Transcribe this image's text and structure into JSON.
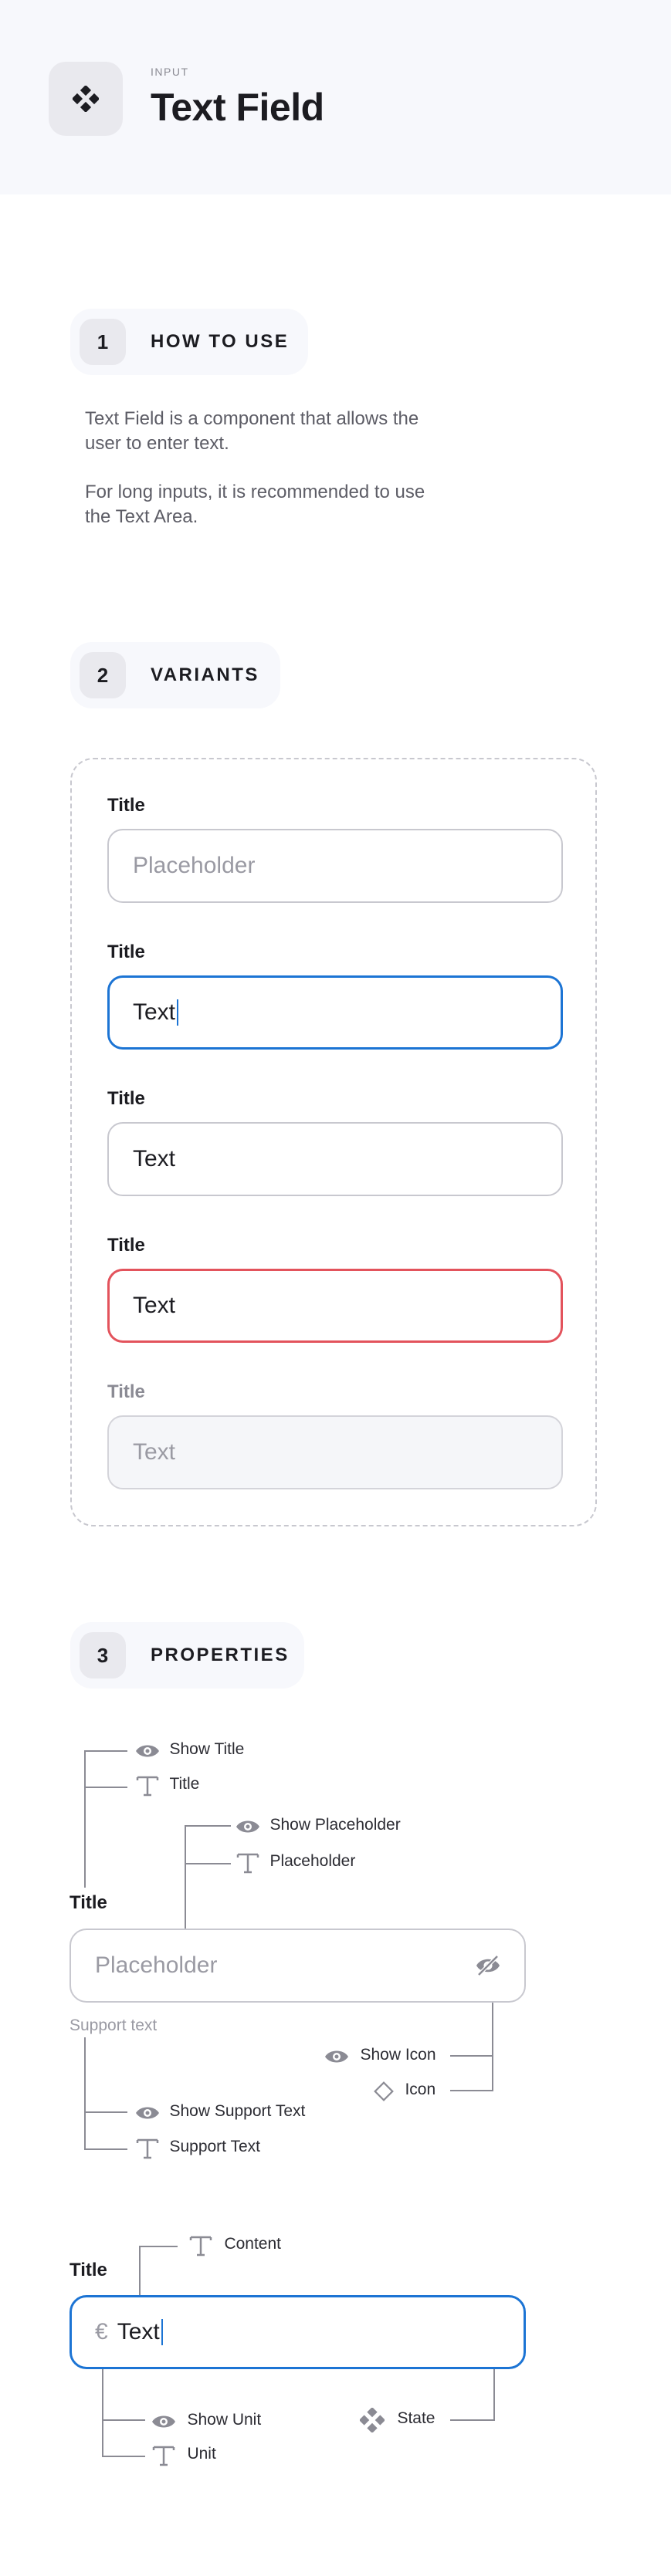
{
  "header": {
    "overline": "INPUT",
    "title": "Text Field",
    "icon": "component-icon"
  },
  "sections": {
    "how_to_use": {
      "number": "1",
      "title": "HOW TO USE",
      "paragraphs": [
        "Text Field is a component that allows the user to enter text.",
        "For long inputs, it is recommended to use the Text Area."
      ]
    },
    "variants": {
      "number": "2",
      "title": "VARIANTS"
    },
    "properties": {
      "number": "3",
      "title": "PROPERTIES"
    }
  },
  "variants": [
    {
      "state": "placeholder",
      "title": "Title",
      "value": "Placeholder"
    },
    {
      "state": "focused",
      "title": "Title",
      "value": "Text"
    },
    {
      "state": "filled",
      "title": "Title",
      "value": "Text"
    },
    {
      "state": "error",
      "title": "Title",
      "value": "Text"
    },
    {
      "state": "disabled",
      "title": "Title",
      "value": "Text"
    }
  ],
  "properties": {
    "diagram1": {
      "field_title": "Title",
      "placeholder": "Placeholder",
      "support_text": "Support text",
      "labels": {
        "show_title": "Show Title",
        "title": "Title",
        "show_placeholder": "Show Placeholder",
        "placeholder": "Placeholder",
        "show_icon": "Show Icon",
        "icon": "Icon",
        "show_support_text": "Show Support Text",
        "support_text": "Support Text"
      }
    },
    "diagram2": {
      "field_title": "Title",
      "unit_symbol": "€",
      "value": "Text",
      "labels": {
        "content": "Content",
        "show_unit": "Show Unit",
        "unit": "Unit",
        "state": "State"
      }
    }
  },
  "colors": {
    "accent": "#1c74d4",
    "error": "#e3535c",
    "border": "#c8c8cf",
    "surface": "#f7f8fc",
    "muted": "#8b8b94"
  }
}
